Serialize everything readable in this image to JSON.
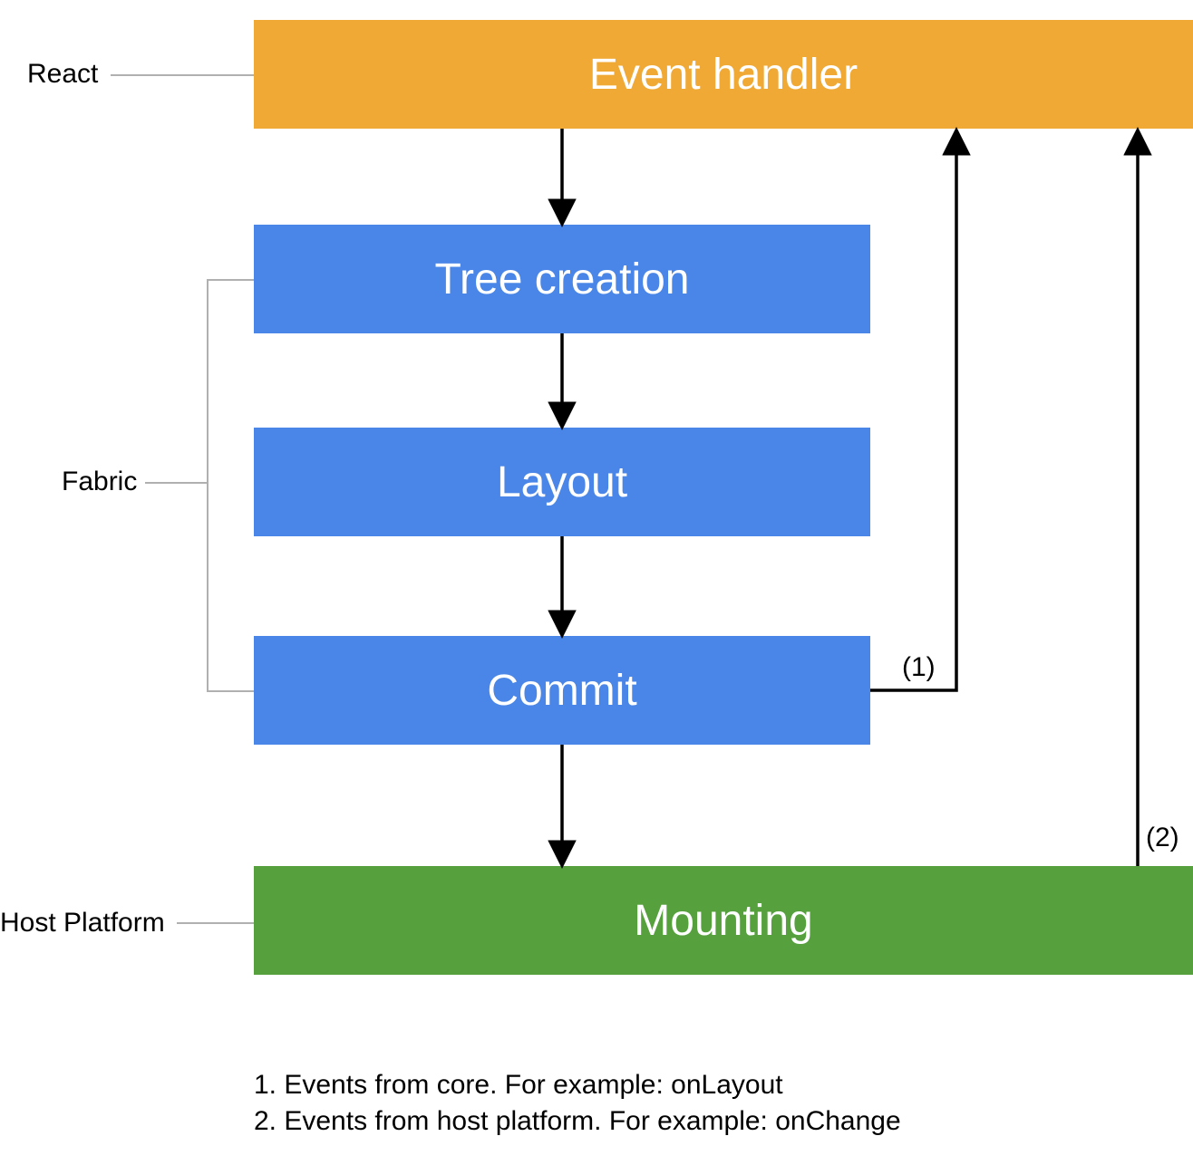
{
  "boxes": {
    "event_handler": "Event handler",
    "tree_creation": "Tree creation",
    "layout": "Layout",
    "commit": "Commit",
    "mounting": "Mounting"
  },
  "side_labels": {
    "react": "React",
    "fabric": "Fabric",
    "host_platform": "Host Platform"
  },
  "annotations": {
    "one": "(1)",
    "two": "(2)"
  },
  "footer": {
    "line1": "1. Events from core. For example: onLayout",
    "line2": "2. Events from host platform. For example: onChange"
  },
  "colors": {
    "orange": "#f0a934",
    "blue": "#4a86e8",
    "green": "#56a03e",
    "line_gray": "#b0b0b0",
    "arrow_black": "#000000"
  },
  "chart_data": {
    "type": "diagram",
    "title": "React rendering pipeline event flow",
    "nodes": [
      {
        "id": "event_handler",
        "label": "Event handler",
        "group": "React",
        "color": "orange"
      },
      {
        "id": "tree_creation",
        "label": "Tree creation",
        "group": "Fabric",
        "color": "blue"
      },
      {
        "id": "layout",
        "label": "Layout",
        "group": "Fabric",
        "color": "blue"
      },
      {
        "id": "commit",
        "label": "Commit",
        "group": "Fabric",
        "color": "blue"
      },
      {
        "id": "mounting",
        "label": "Mounting",
        "group": "Host Platform",
        "color": "green"
      }
    ],
    "edges": [
      {
        "from": "event_handler",
        "to": "tree_creation"
      },
      {
        "from": "tree_creation",
        "to": "layout"
      },
      {
        "from": "layout",
        "to": "commit"
      },
      {
        "from": "commit",
        "to": "mounting"
      },
      {
        "from": "commit",
        "to": "event_handler",
        "label": "(1)",
        "note": "Events from core. For example: onLayout"
      },
      {
        "from": "mounting",
        "to": "event_handler",
        "label": "(2)",
        "note": "Events from host platform. For example: onChange"
      }
    ],
    "groups": [
      {
        "name": "React",
        "members": [
          "event_handler"
        ]
      },
      {
        "name": "Fabric",
        "members": [
          "tree_creation",
          "layout",
          "commit"
        ]
      },
      {
        "name": "Host Platform",
        "members": [
          "mounting"
        ]
      }
    ]
  }
}
